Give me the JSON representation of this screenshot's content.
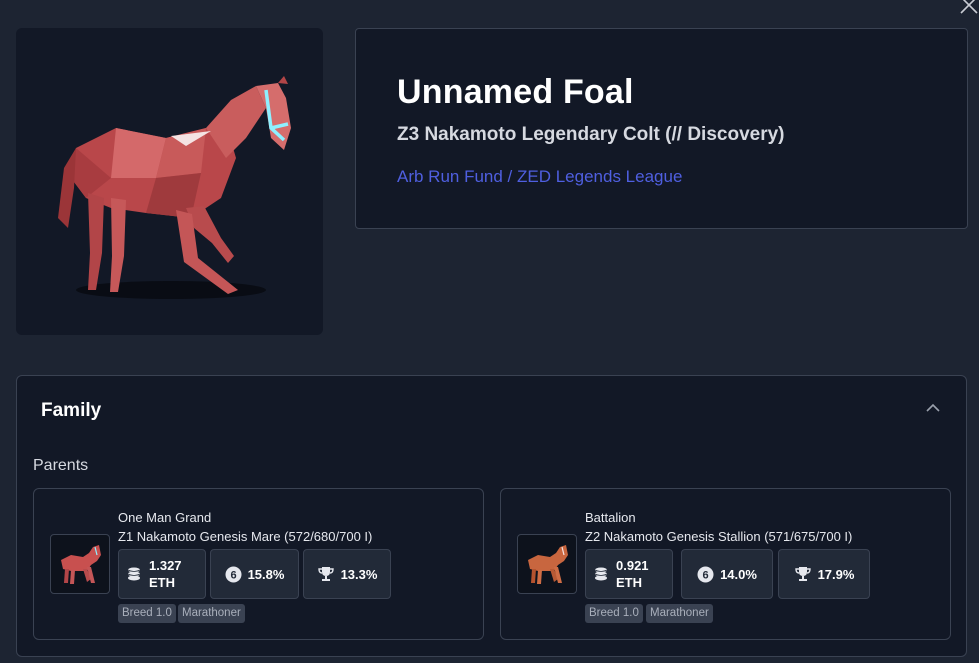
{
  "horse": {
    "name": "Unnamed Foal",
    "description": "Z3 Nakamoto Legendary Colt (// Discovery)",
    "owner_link": "Arb Run Fund / ZED Legends League"
  },
  "family": {
    "title": "Family",
    "parents_label": "Parents",
    "parents": [
      {
        "name": "One Man Grand",
        "description": "Z1 Nakamoto Genesis Mare (572/680/700 I)",
        "price": "1.327",
        "currency": "ETH",
        "win_rate": "15.8%",
        "place_rate": "13.3%",
        "tags": [
          "Breed 1.0",
          "Marathoner"
        ],
        "coat_color": "#c8504f"
      },
      {
        "name": "Battalion",
        "description": "Z2 Nakamoto Genesis Stallion (571/675/700 I)",
        "price": "0.921",
        "currency": "ETH",
        "win_rate": "14.0%",
        "place_rate": "17.9%",
        "tags": [
          "Breed 1.0",
          "Marathoner"
        ],
        "coat_color": "#c8663f"
      }
    ]
  },
  "icons": {
    "close": "close-icon",
    "zoom": "zoom-in-icon",
    "collapse": "chevron-up-icon",
    "coins": "coins-icon",
    "win": "number-six-badge-icon",
    "trophy": "trophy-icon"
  },
  "colors": {
    "background": "#1d2432",
    "card": "#121826",
    "border": "#3a4252",
    "link": "#4f5fe0",
    "horse_coat": "#c85a58",
    "bridle": "#8ef0ff"
  }
}
